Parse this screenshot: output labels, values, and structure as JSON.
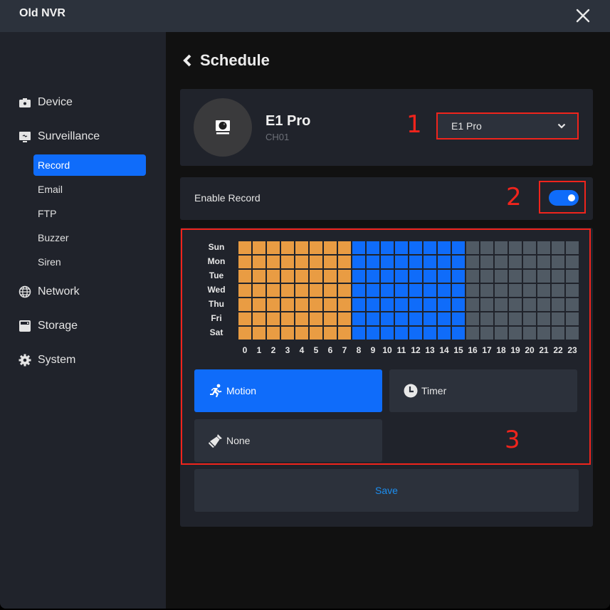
{
  "app": {
    "title": "Old NVR",
    "close_icon": "close-icon"
  },
  "sidebar": {
    "items": [
      {
        "label": "Device",
        "icon": "camera-icon"
      },
      {
        "label": "Surveillance",
        "icon": "monitor-icon",
        "expanded": true,
        "sub_items": [
          {
            "label": "Record",
            "active": true
          },
          {
            "label": "Email",
            "active": false
          },
          {
            "label": "FTP",
            "active": false
          },
          {
            "label": "Buzzer",
            "active": false
          },
          {
            "label": "Siren",
            "active": false
          }
        ]
      },
      {
        "label": "Network",
        "icon": "globe-icon"
      },
      {
        "label": "Storage",
        "icon": "storage-icon"
      },
      {
        "label": "System",
        "icon": "gear-icon"
      }
    ]
  },
  "page": {
    "title": "Schedule",
    "back_icon": "chevron-left-icon"
  },
  "device": {
    "name": "E1 Pro",
    "channel": "CH01",
    "icon": "webcam-icon",
    "select": {
      "value": "E1 Pro",
      "icon": "chevron-down-icon"
    }
  },
  "enable_record": {
    "label": "Enable Record",
    "enabled": true
  },
  "schedule": {
    "days": [
      "Sun",
      "Mon",
      "Tue",
      "Wed",
      "Thu",
      "Fri",
      "Sat"
    ],
    "hours": [
      "0",
      "1",
      "2",
      "3",
      "4",
      "5",
      "6",
      "7",
      "8",
      "9",
      "10",
      "11",
      "12",
      "13",
      "14",
      "15",
      "16",
      "17",
      "18",
      "19",
      "20",
      "21",
      "22",
      "23"
    ],
    "mode_colors": {
      "timer": "#e99c43",
      "motion": "#0f6cfa",
      "none": "#505a64"
    },
    "hour_modes": [
      "timer",
      "timer",
      "timer",
      "timer",
      "timer",
      "timer",
      "timer",
      "timer",
      "motion",
      "motion",
      "motion",
      "motion",
      "motion",
      "motion",
      "motion",
      "motion",
      "none",
      "none",
      "none",
      "none",
      "none",
      "none",
      "none",
      "none"
    ]
  },
  "modes": [
    {
      "key": "motion",
      "label": "Motion",
      "icon": "running-icon",
      "active": true
    },
    {
      "key": "timer",
      "label": "Timer",
      "icon": "clock-icon",
      "active": false
    },
    {
      "key": "none",
      "label": "None",
      "icon": "brush-icon",
      "active": false
    }
  ],
  "save_label": "Save",
  "annotations": [
    "1",
    "2",
    "3"
  ]
}
